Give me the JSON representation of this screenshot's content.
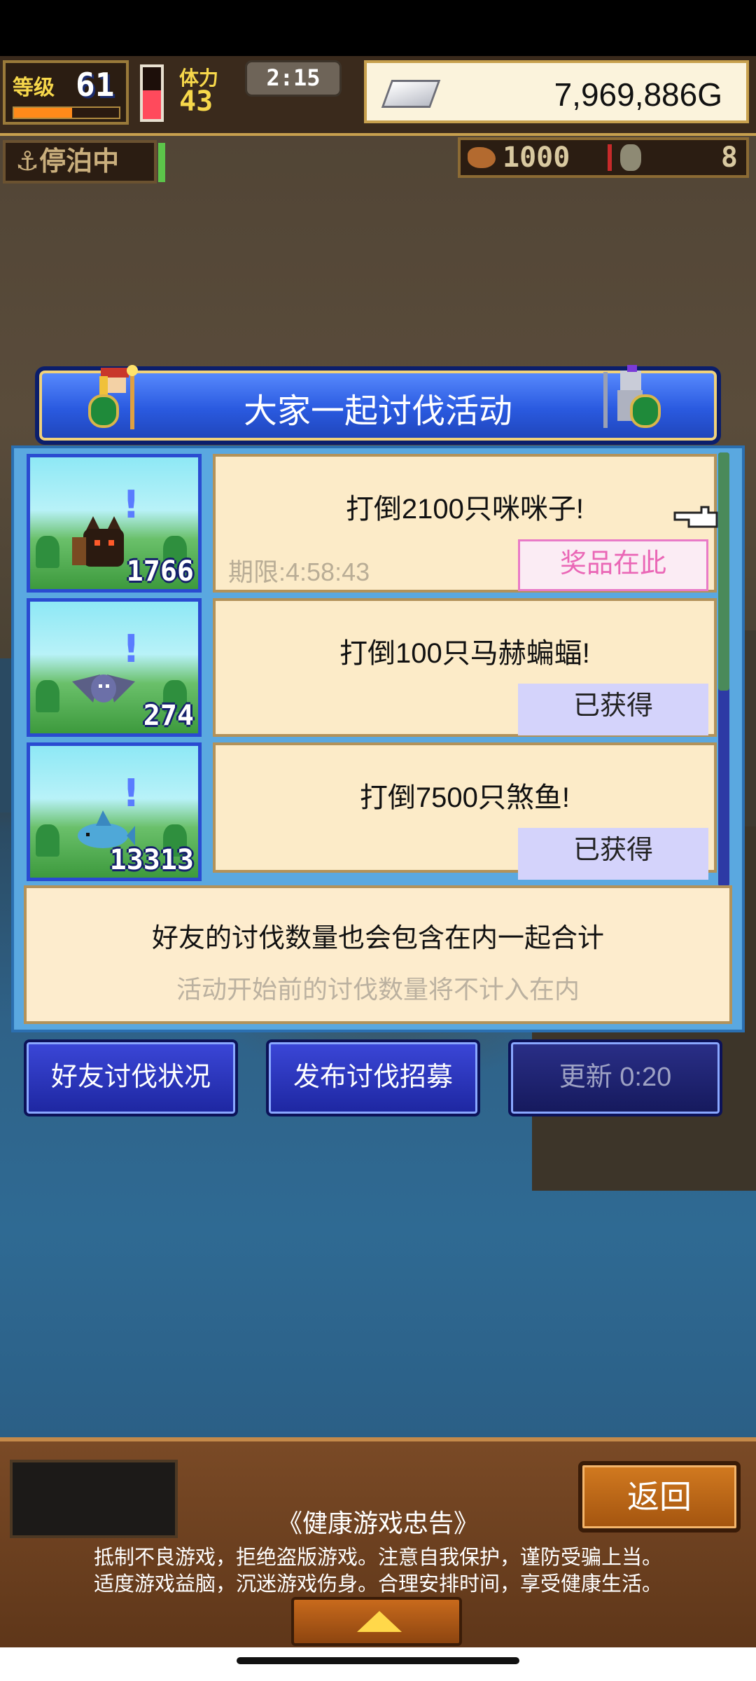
{
  "hud": {
    "level_label": "等级",
    "level_value": "61",
    "level_progress": 0.55,
    "stamina_label": "体力",
    "stamina_value": "43",
    "stamina_level": 0.55,
    "timer": "2:15",
    "gold": "7,969,886G",
    "status": "停泊中",
    "resource_1": "1000",
    "resource_2": "8"
  },
  "dialog": {
    "title": "大家一起讨伐活动",
    "missions": [
      {
        "title": "打倒2100只咪咪子!",
        "count": "1766",
        "deadline": "期限:4:58:43",
        "button": "奖品在此",
        "state": "prize"
      },
      {
        "title": "打倒100只马赫蝙蝠!",
        "count": "274",
        "deadline": "",
        "button": "已获得",
        "state": "obtained"
      },
      {
        "title": "打倒7500只煞鱼!",
        "count": "13313",
        "deadline": "",
        "button": "已获得",
        "state": "obtained"
      }
    ],
    "info_main": "好友的讨伐数量也会包含在内一起合计",
    "info_sub": "活动开始前的讨伐数量将不计入在内",
    "buttons": {
      "friend_status": "好友讨伐状况",
      "post_recruit": "发布讨伐招募",
      "update": "更新 0:20"
    }
  },
  "bottom": {
    "back": "返回",
    "notice_title": "《健康游戏忠告》",
    "notice_line_1": "抵制不良游戏，拒绝盗版游戏。注意自我保护，谨防受骗上当。",
    "notice_line_2": "适度游戏益脑，沉迷游戏伤身。合理安排时间，享受健康生活。"
  },
  "colors": {
    "dialog_blue": "#2a5ae0",
    "card_bg": "#fcebc8",
    "prize_pink": "#ea67b6",
    "obtained_lavender": "#d4d3fb",
    "gold_yellow": "#f7d84b"
  },
  "icons": [
    "anchor-icon",
    "silver-bar-icon",
    "mimiko-monster-icon",
    "mach-bat-monster-icon",
    "shark-fish-monster-icon",
    "pointer-hand-icon",
    "up-arrow-icon"
  ]
}
